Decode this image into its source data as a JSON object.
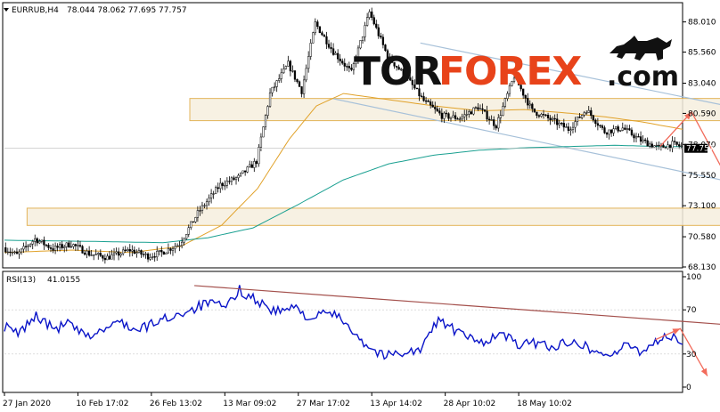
{
  "chart_data": [
    {
      "type": "candlestick",
      "symbol": "EURRUB,H4",
      "ohlc_values": "78.044 78.062 77.695 77.757",
      "last_price": "77.757",
      "y_ticks": [
        "88.010",
        "85.560",
        "83.040",
        "80.590",
        "78.070",
        "75.550",
        "73.100",
        "70.580",
        "68.130"
      ],
      "ylim": [
        68.13,
        89.5
      ],
      "x_ticks": [
        "27 Jan 2020",
        "10 Feb 17:02",
        "26 Feb 13:02",
        "13 Mar 09:02",
        "27 Mar 17:02",
        "13 Apr 14:02",
        "28 Apr 10:02",
        "18 May 10:02"
      ],
      "price_anchors": [
        [
          0,
          69.7
        ],
        [
          6,
          69.1
        ],
        [
          14,
          70.4
        ],
        [
          22,
          69.6
        ],
        [
          30,
          70.0
        ],
        [
          38,
          69.2
        ],
        [
          46,
          68.9
        ],
        [
          56,
          69.5
        ],
        [
          64,
          69.0
        ],
        [
          70,
          69.3
        ],
        [
          78,
          70.0
        ],
        [
          86,
          72.5
        ],
        [
          96,
          74.8
        ],
        [
          104,
          75.4
        ],
        [
          112,
          76.7
        ],
        [
          118,
          82.2
        ],
        [
          126,
          84.6
        ],
        [
          132,
          82.4
        ],
        [
          138,
          87.9
        ],
        [
          146,
          85.6
        ],
        [
          154,
          83.9
        ],
        [
          162,
          88.8
        ],
        [
          170,
          85.2
        ],
        [
          178,
          83.6
        ],
        [
          186,
          81.6
        ],
        [
          194,
          80.4
        ],
        [
          202,
          80.2
        ],
        [
          210,
          81.1
        ],
        [
          218,
          79.6
        ],
        [
          226,
          83.6
        ],
        [
          234,
          80.8
        ],
        [
          242,
          80.1
        ],
        [
          250,
          79.3
        ],
        [
          258,
          80.9
        ],
        [
          266,
          79.1
        ],
        [
          274,
          79.4
        ],
        [
          282,
          78.4
        ],
        [
          290,
          77.8
        ],
        [
          296,
          78.1
        ],
        [
          300,
          77.9
        ]
      ],
      "moving_averages": [
        {
          "color": "#e1a22a",
          "points": [
            [
              0,
              69.3
            ],
            [
              30,
              69.5
            ],
            [
              56,
              69.3
            ],
            [
              78,
              69.8
            ],
            [
              96,
              71.5
            ],
            [
              112,
              74.5
            ],
            [
              126,
              78.5
            ],
            [
              138,
              81.2
            ],
            [
              150,
              82.2
            ],
            [
              170,
              81.7
            ],
            [
              190,
              81.2
            ],
            [
              210,
              80.8
            ],
            [
              230,
              80.9
            ],
            [
              250,
              80.6
            ],
            [
              266,
              80.3
            ],
            [
              282,
              79.9
            ],
            [
              300,
              79.3
            ]
          ]
        },
        {
          "color": "#1aa091",
          "points": [
            [
              0,
              70.3
            ],
            [
              40,
              70.2
            ],
            [
              70,
              70.1
            ],
            [
              90,
              70.5
            ],
            [
              110,
              71.3
            ],
            [
              130,
              73.2
            ],
            [
              150,
              75.2
            ],
            [
              170,
              76.5
            ],
            [
              190,
              77.2
            ],
            [
              210,
              77.6
            ],
            [
              230,
              77.8
            ],
            [
              250,
              77.9
            ],
            [
              270,
              78.0
            ],
            [
              290,
              77.9
            ],
            [
              300,
              77.9
            ]
          ]
        }
      ],
      "zones": [
        {
          "from": 80.0,
          "to": 81.8,
          "x0": 82,
          "x1": 358
        },
        {
          "from": 71.5,
          "to": 72.9,
          "x0": 10,
          "x1": 433
        }
      ],
      "channel_lines": [
        {
          "color": "#a7c1d9",
          "x0": 184,
          "y0": 86.3,
          "x1": 370,
          "y1": 79.3
        },
        {
          "color": "#a7c1d9",
          "x0": 145,
          "y0": 81.8,
          "x1": 330,
          "y1": 74.7
        }
      ],
      "forecast_arrows": [
        {
          "color": "#f26b5b",
          "points": [
            [
              290,
              77.9
            ],
            [
              304,
              80.7
            ],
            [
              326,
              73.2
            ]
          ]
        }
      ]
    },
    {
      "type": "line",
      "indicator": "RSI(13)",
      "value_label": "41.0155",
      "color": "#0a14c8",
      "y_ticks": [
        "100",
        "70",
        "30",
        "0"
      ],
      "ylim": [
        0,
        100
      ],
      "levels": [
        70,
        30
      ],
      "anchors": [
        [
          0,
          55
        ],
        [
          6,
          48
        ],
        [
          14,
          65
        ],
        [
          22,
          52
        ],
        [
          28,
          58
        ],
        [
          36,
          45
        ],
        [
          44,
          52
        ],
        [
          52,
          60
        ],
        [
          58,
          50
        ],
        [
          66,
          58
        ],
        [
          74,
          64
        ],
        [
          82,
          70
        ],
        [
          90,
          76
        ],
        [
          98,
          72
        ],
        [
          104,
          88
        ],
        [
          112,
          78
        ],
        [
          120,
          68
        ],
        [
          128,
          72
        ],
        [
          136,
          62
        ],
        [
          144,
          68
        ],
        [
          152,
          57
        ],
        [
          160,
          38
        ],
        [
          168,
          28
        ],
        [
          176,
          32
        ],
        [
          184,
          33
        ],
        [
          192,
          62
        ],
        [
          200,
          50
        ],
        [
          210,
          40
        ],
        [
          220,
          48
        ],
        [
          228,
          38
        ],
        [
          236,
          40
        ],
        [
          244,
          36
        ],
        [
          252,
          44
        ],
        [
          260,
          33
        ],
        [
          268,
          29
        ],
        [
          276,
          38
        ],
        [
          282,
          32
        ],
        [
          288,
          42
        ],
        [
          294,
          46
        ],
        [
          300,
          40
        ]
      ],
      "trendline": {
        "color": "#a4504c",
        "x0": 84,
        "y0": 92,
        "x1": 330,
        "y1": 55
      },
      "forecast_arrow": {
        "color": "#f26b5b",
        "points": [
          [
            288,
            43
          ],
          [
            299,
            53
          ],
          [
            311,
            10
          ]
        ]
      }
    }
  ],
  "logo": {
    "part1": "TOR",
    "part2": "FOREX",
    "part3": ".com"
  }
}
